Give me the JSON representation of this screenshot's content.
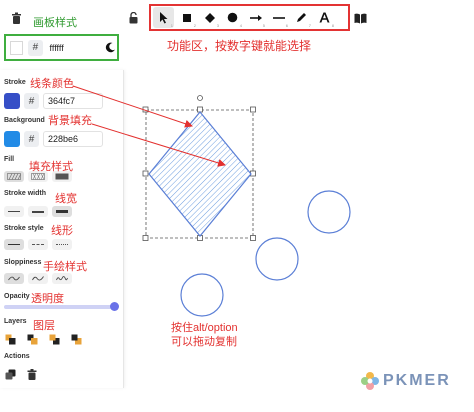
{
  "panel": {
    "stroke_label": "Stroke",
    "stroke_hex": "364fc7",
    "stroke_color": "#364fc7",
    "background_label": "Background",
    "background_hex": "228be6",
    "background_color": "#228be6",
    "fill_label": "Fill",
    "stroke_width_label": "Stroke width",
    "stroke_style_label": "Stroke style",
    "sloppiness_label": "Sloppiness",
    "opacity_label": "Opacity",
    "opacity_value": 1.0,
    "layers_label": "Layers",
    "actions_label": "Actions"
  },
  "canvas_bg": {
    "hash": "#",
    "hex": "ffffff"
  },
  "toolbar": {
    "tools": [
      "selection",
      "rectangle",
      "diamond",
      "ellipse",
      "arrow",
      "line",
      "draw",
      "text"
    ],
    "active_tool": "selection"
  },
  "annotations": {
    "canvas_style": "画板样式",
    "tool_area": "功能区，按数字键就能选择",
    "stroke_color": "线条颜色",
    "background_fill": "背景填充",
    "fill_style": "填充样式",
    "stroke_width": "线宽",
    "stroke_style": "线形",
    "sloppiness": "手绘样式",
    "opacity": "透明度",
    "layers": "图层",
    "alt_hint_line1": "按住alt/option",
    "alt_hint_line2": "可以拖动复制"
  },
  "colors": {
    "accent_red": "#e3312f",
    "accent_green": "#3fae3f",
    "brand_blue": "#6a72e8"
  },
  "logo": {
    "text": "PKMER"
  }
}
